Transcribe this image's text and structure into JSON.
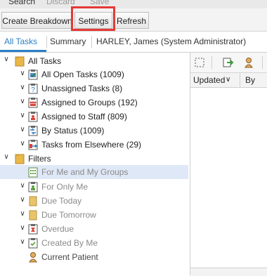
{
  "menu": {
    "search": "Search",
    "discard": "Discard",
    "save": "Save"
  },
  "toolbar": {
    "create_breakdown": "Create Breakdown",
    "settings": "Settings",
    "refresh": "Refresh"
  },
  "tabs": {
    "all_tasks": "All Tasks",
    "summary": "Summary",
    "user": "HARLEY, James (System Administrator)"
  },
  "tree": {
    "all_tasks": {
      "label": "All Tasks",
      "items": [
        "All Open Tasks (1009)",
        "Unassigned Tasks (8)",
        "Assigned to Groups (192)",
        "Assigned to Staff (809)",
        "By Status (1009)",
        "Tasks from Elsewhere (29)"
      ]
    },
    "filters": {
      "label": "Filters",
      "items": [
        "For Me and My Groups",
        "For Only Me",
        "Due Today",
        "Due Tomorrow",
        "Overdue",
        "Created By Me",
        "Current Patient"
      ]
    }
  },
  "columns": {
    "updated": "Updated",
    "by": "By"
  },
  "colors": {
    "accent": "#2a7fc6",
    "highlight_box": "#e53935",
    "selected_row": "#dfe8f7"
  }
}
